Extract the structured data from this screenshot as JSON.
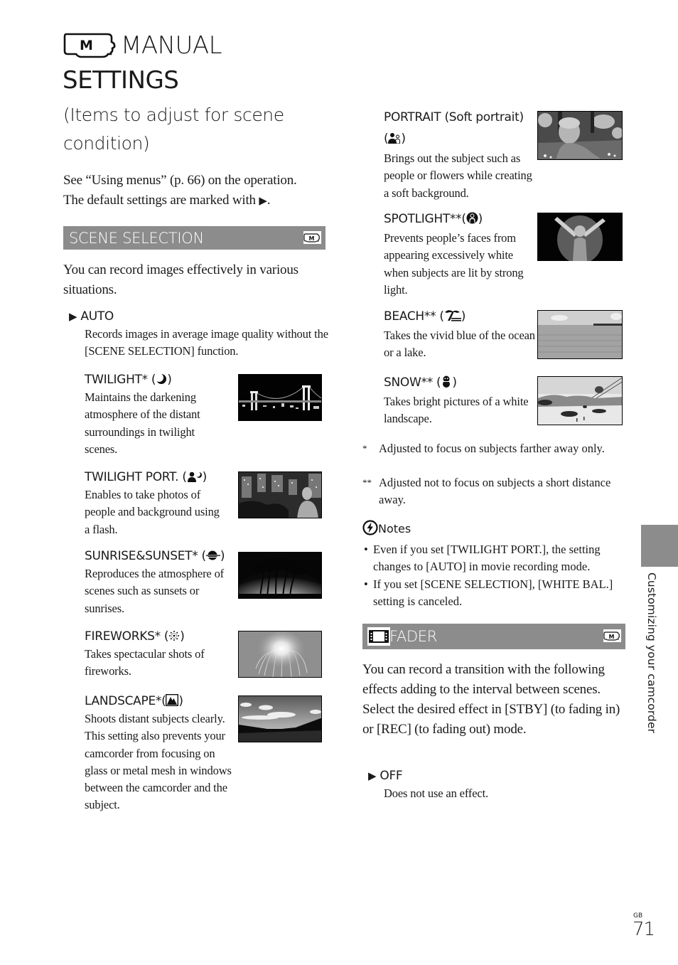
{
  "header": {
    "title_line1": "MANUAL",
    "title_line2": "SETTINGS",
    "title_icon": "camera-m-mode-icon",
    "subtitle": "(Items to adjust for scene condition)"
  },
  "intro": {
    "line1": "See “Using menus” (p. 66) on the operation.",
    "line2_prefix": "The default settings are marked with ",
    "default_marker": "▶",
    "line2_suffix": "."
  },
  "scene_selection": {
    "heading": "SCENE SELECTION",
    "mode_badge_icon": "camera-m-mode-icon",
    "intro": "You can record images effectively in various situations.",
    "items": [
      {
        "title": "AUTO",
        "is_default": true,
        "icon": null,
        "description": "Records images in average image quality without the [SCENE SELECTION] function.",
        "image": null
      },
      {
        "title": "TWILIGHT* (",
        "icon": "twilight-moon-icon",
        "title_suffix": ")",
        "description": "Maintains the darkening atmosphere of the distant surroundings in twilight scenes.",
        "image": "night-bridge-photo"
      },
      {
        "title": "TWILIGHT PORT. (",
        "icon": "twilight-portrait-icon",
        "title_suffix": ")",
        "description": "Enables to take photos of people and background using a flash.",
        "image": "night-city-portrait-photo"
      },
      {
        "title": "SUNRISE&SUNSET* (",
        "icon": "sunset-icon",
        "title_suffix": ")",
        "description": "Reproduces the atmosphere of scenes such as sunsets or sunrises.",
        "image": "palm-trees-sunset-photo"
      },
      {
        "title": "FIREWORKS* (",
        "icon": "fireworks-icon",
        "title_suffix": ")",
        "description": "Takes spectacular shots of fireworks.",
        "image": "fireworks-photo"
      },
      {
        "title": "LANDSCAPE*(",
        "icon": "landscape-mountain-icon",
        "title_suffix": ")",
        "description": "Shoots distant subjects clearly. This setting also prevents your camcorder from focusing on glass or metal mesh in windows between the camcorder and the subject.",
        "image": "landscape-road-photo"
      },
      {
        "title": "PORTRAIT (Soft portrait)",
        "icon": "soft-portrait-icon",
        "title_prefix2": "(",
        "title_suffix": ")",
        "description": "Brings out the subject such as people or flowers while creating a soft background.",
        "image": "child-portrait-photo"
      },
      {
        "title": "SPOTLIGHT**(",
        "icon": "spotlight-icon",
        "title_suffix": ")",
        "description": "Prevents people’s faces from appearing excessively white when subjects are lit by strong light.",
        "image": "spotlight-child-photo"
      },
      {
        "title": "BEACH** (",
        "icon": "beach-palm-icon",
        "title_suffix": ")",
        "description": "Takes the vivid blue of the ocean or a lake.",
        "image": "beach-ocean-photo"
      },
      {
        "title": "SNOW** (",
        "icon": "snowman-icon",
        "title_suffix": ")",
        "description": "Takes bright pictures of a white landscape.",
        "image": "snow-ropeway-photo"
      }
    ]
  },
  "footnotes": [
    {
      "mark": "*",
      "text": "Adjusted to focus on subjects farther away only."
    },
    {
      "mark": "**",
      "text": "Adjusted not to focus on subjects a short distance away."
    }
  ],
  "notes": {
    "heading": "Notes",
    "icon": "notes-caution-icon",
    "bullets": [
      "Even if you set [TWILIGHT PORT.], the setting changes to [AUTO] in movie recording mode.",
      "If you set [SCENE SELECTION], [WHITE BAL.] setting is canceled."
    ]
  },
  "fader": {
    "heading": "FADER",
    "heading_icon": "film-strip-icon",
    "mode_badge_icon": "camera-m-mode-icon",
    "intro_1": "You can record a transition with the following effects adding to the interval between scenes.",
    "intro_2": "Select the desired effect in [STBY] (to fading in) or [REC] (to fading out) mode.",
    "items": [
      {
        "title": "OFF",
        "is_default": true,
        "description": "Does not use an effect."
      }
    ]
  },
  "side_tab": {
    "label": "Customizing your camcorder"
  },
  "page": {
    "region": "GB",
    "number": "71"
  },
  "colors": {
    "section_bar": "#8c8c8c",
    "text": "#1a1a1a",
    "side_tab": "#8c8c8c"
  }
}
